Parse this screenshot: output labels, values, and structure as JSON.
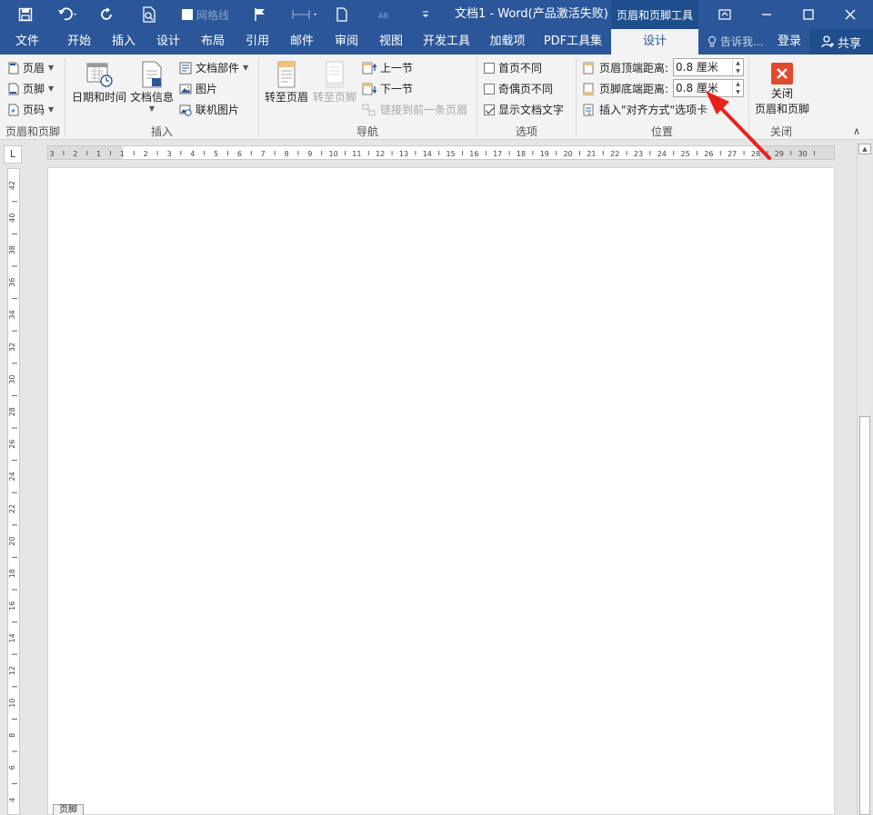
{
  "titlebar": {
    "icons": [
      "save-icon",
      "undo-icon",
      "redo-icon",
      "print-preview-icon",
      "flag-icon",
      "ruler-icon",
      "new-doc-icon",
      "font-icon",
      "customize-icon"
    ],
    "checkbox_label": "网格线",
    "title": "文档1 - Word(产品激活失败)",
    "context_tab": "页眉和页脚工具",
    "window_buttons": [
      "ribbon-display-icon",
      "minimize-icon",
      "maximize-icon",
      "close-icon"
    ]
  },
  "tabs": [
    {
      "label": "文件"
    },
    {
      "label": "开始"
    },
    {
      "label": "插入"
    },
    {
      "label": "设计"
    },
    {
      "label": "布局"
    },
    {
      "label": "引用"
    },
    {
      "label": "邮件"
    },
    {
      "label": "审阅"
    },
    {
      "label": "视图"
    },
    {
      "label": "开发工具"
    },
    {
      "label": "加载项"
    },
    {
      "label": "PDF工具集"
    },
    {
      "label": "设计",
      "active": true
    }
  ],
  "tell_me": "告诉我...",
  "login": "登录",
  "share": "共享",
  "ribbon": {
    "hf_group": {
      "items": [
        "页眉",
        "页脚",
        "页码"
      ],
      "label": "页眉和页脚"
    },
    "insert_group": {
      "datetime": "日期和时间",
      "docinfo": "文档信息",
      "parts": "文档部件",
      "picture": "图片",
      "online_picture": "联机图片",
      "label": "插入"
    },
    "nav_group": {
      "goto_header": "转至页眉",
      "goto_footer": "转至页脚",
      "prev": "上一节",
      "next": "下一节",
      "link_prev": "链接到前一条页眉",
      "label": "导航"
    },
    "options_group": {
      "first_page": "首页不同",
      "odd_even": "奇偶页不同",
      "show_text": "显示文档文字",
      "show_text_checked": true,
      "label": "选项"
    },
    "position_group": {
      "header_distance_label": "页眉顶端距离:",
      "header_distance_value": "0.8 厘米",
      "footer_distance_label": "页脚底端距离:",
      "footer_distance_value": "0.8 厘米",
      "insert_align_tab": "插入\"对齐方式\"选项卡",
      "label": "位置"
    },
    "close_group": {
      "close_line1": "关闭",
      "close_line2": "页眉和页脚",
      "label": "关闭"
    }
  },
  "ruler": {
    "tab_marker": "L",
    "h_labels": [
      "3",
      "2",
      "1",
      "1",
      "2",
      "3",
      "4",
      "5",
      "6",
      "7",
      "8",
      "9",
      "10",
      "11",
      "12",
      "13",
      "14",
      "15",
      "16",
      "17",
      "18",
      "19",
      "20",
      "21",
      "22",
      "23",
      "24",
      "25",
      "26",
      "27",
      "28",
      "29",
      "30"
    ],
    "v_labels": [
      "42",
      "40",
      "38",
      "36",
      "34",
      "32",
      "30",
      "28",
      "26",
      "24",
      "22",
      "20",
      "18",
      "16",
      "14",
      "12",
      "10",
      "8",
      "6",
      "4"
    ]
  },
  "footer_tag": "页脚",
  "colors": {
    "title_blue": "#2b579a",
    "ribbon_bg": "#f3f3f3",
    "annotation_red": "#e8221b"
  }
}
